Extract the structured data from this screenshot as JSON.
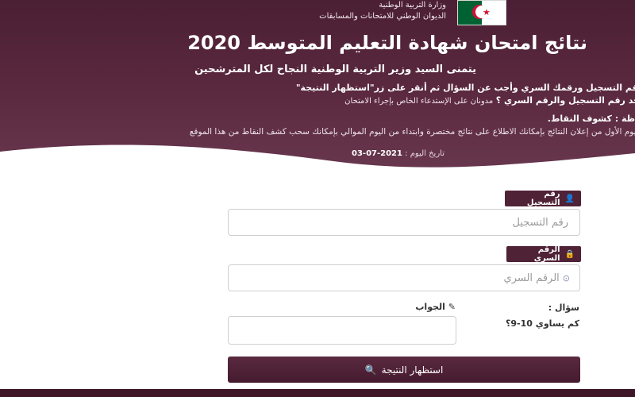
{
  "header": {
    "ministry_lines": [
      "وزارة التربية الوطنية",
      "الديوان الوطني للامتحانات والمسابقات"
    ],
    "title": "نتائج امتحان شهادة التعليم المتوسط 2020",
    "wish": "يتمنى السيد وزير التربية الوطنية النجاح لكل المترشحين",
    "instruction_1": "رقم التسجيل ورقمك السري وأجب عن السؤال ثم أنقر على زر\"استظهار النتيجة\"",
    "instruction_2_bold": "جد رقم التسجيل والرقم السري ؟",
    "instruction_2_rest": "مدونان على الإستدعاء الخاص بإجراء الامتحان",
    "note_label": "ظة : كشوف النقاط.",
    "note_text": "اليوم الأول من إعلان النتائج بإمكانك الاطلاع على نتائج مختصرة وابتداء من اليوم الموالي بإمكانك سحب كشف النقاط من هذا الموقع",
    "date_label": "تاريخ اليوم :",
    "date_value": "2021-07-03"
  },
  "form": {
    "registration": {
      "label": "رقم التسجيل",
      "icon": "user-icon",
      "placeholder": "رقم التسجيل"
    },
    "secret": {
      "label": "الرقم السري",
      "icon": "lock-icon",
      "placeholder": "الرقم السري"
    },
    "question": {
      "label": "سؤال :",
      "text": "كم يساوي 10-9؟"
    },
    "answer": {
      "label": "الجواب",
      "icon": "pencil-icon"
    },
    "submit": {
      "label": "استظهار النتيجة",
      "icon": "search-icon"
    }
  },
  "colors": {
    "brand": "#4f2236",
    "header_bg": "#5c2a41",
    "flag_green": "#006233",
    "flag_red": "#d21034"
  }
}
